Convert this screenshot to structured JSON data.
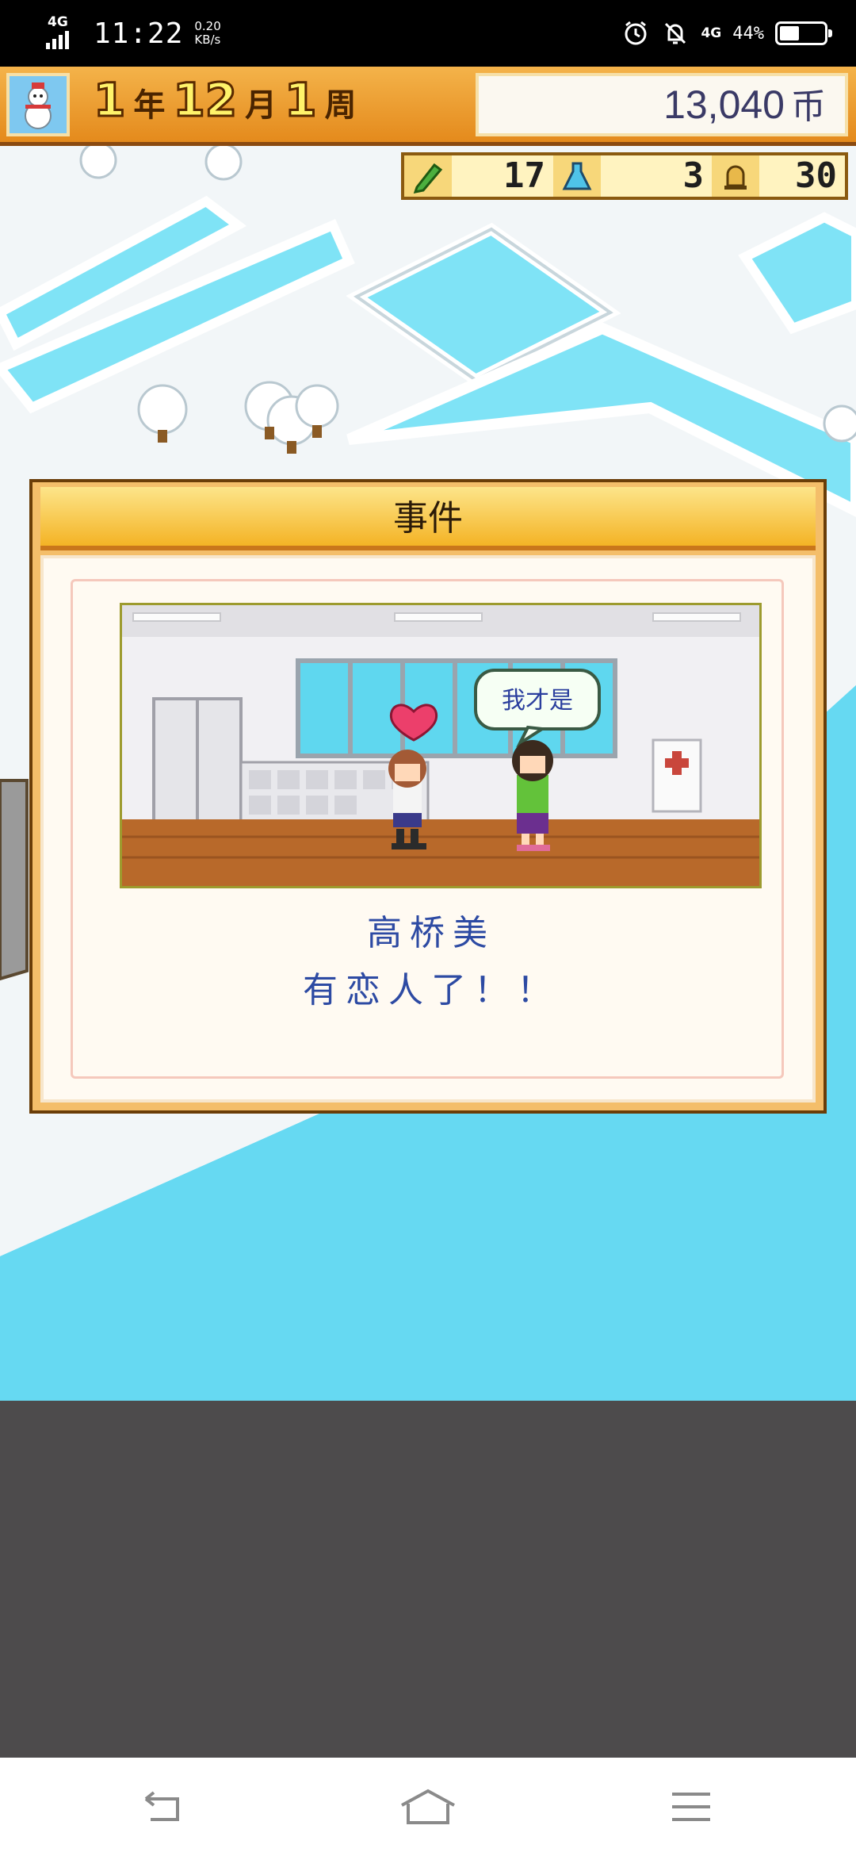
{
  "status_bar": {
    "signal_label": "4G",
    "time": "11:22",
    "speed_value": "0.20",
    "speed_unit": "KB/s",
    "network_label": "4G",
    "battery_percent": "44%",
    "battery_level": 0.44,
    "icons": [
      "alarm-icon",
      "mute-icon"
    ]
  },
  "hud": {
    "date": {
      "year": "1",
      "year_unit": "年",
      "month": "12",
      "month_unit": "月",
      "week": "1",
      "week_unit": "周"
    },
    "money": {
      "amount": "13,040",
      "currency": "币"
    },
    "stats": [
      {
        "icon": "pencil-icon",
        "value": "17"
      },
      {
        "icon": "flask-icon",
        "value": "3"
      },
      {
        "icon": "bell-icon",
        "value": "30"
      }
    ]
  },
  "event_dialog": {
    "title": "事件",
    "speech_bubble": "我才是",
    "message_line1": "高桥美",
    "message_line2": "有恋人了！！"
  },
  "navigation": {
    "items": [
      "back-icon",
      "home-icon",
      "menu-icon"
    ]
  },
  "colors": {
    "sky": "#66d9f2",
    "hud_orange": "#e48a1c",
    "dialog_text": "#2d4aa3"
  }
}
